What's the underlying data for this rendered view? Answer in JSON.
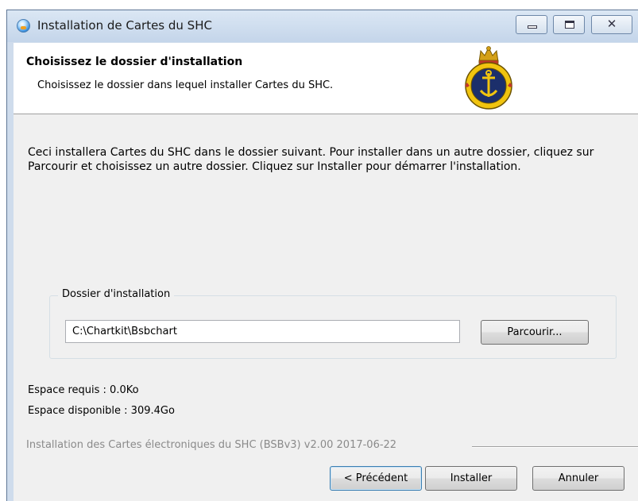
{
  "window": {
    "title": "Installation de Cartes du SHC"
  },
  "header": {
    "title": "Choisissez le dossier d'installation",
    "subtitle": "Choisissez le dossier dans lequel installer Cartes du SHC."
  },
  "body": {
    "instructions": "Ceci installera Cartes du SHC dans le dossier suivant. Pour installer dans un autre dossier, cliquez sur Parcourir et choisissez un autre dossier. Cliquez sur Installer pour démarrer l'installation."
  },
  "install_folder": {
    "legend": "Dossier d'installation",
    "path": "C:\\Chartkit\\Bsbchart",
    "browse_label": "Parcourir..."
  },
  "space": {
    "required": "Espace requis : 0.0Ko",
    "available": "Espace disponible : 309.4Go"
  },
  "branding": "Installation des Cartes électroniques du SHC (BSBv3) v2.00 2017-06-22",
  "buttons": {
    "back": "< Précédent",
    "install": "Installer",
    "cancel": "Annuler"
  },
  "icons": {
    "app": "installer-globe-icon",
    "logo": "chs-crest-logo"
  },
  "colors": {
    "titlebar": "#c4d5ea",
    "client_bg": "#f0f0f0",
    "focus_border": "#3c7fb1"
  }
}
